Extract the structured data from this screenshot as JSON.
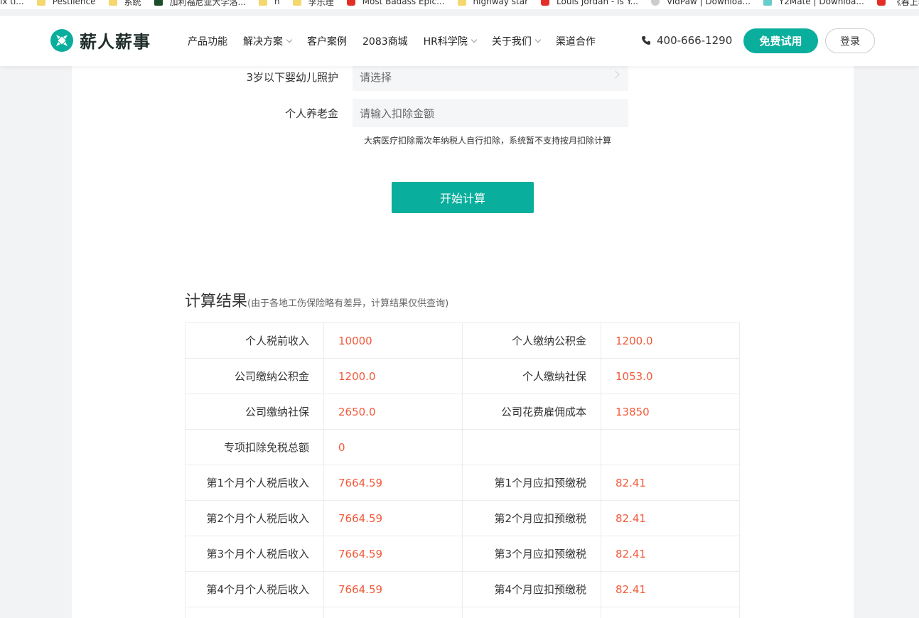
{
  "bookmarks": [
    {
      "label": "ix ti...",
      "icon": "none"
    },
    {
      "label": "Pestilence",
      "icon": "folder-icon"
    },
    {
      "label": "系统",
      "icon": "folder-icon"
    },
    {
      "label": "加利福尼亚大学洛...",
      "icon": "play-icon"
    },
    {
      "label": "n",
      "icon": "folder-icon"
    },
    {
      "label": "李乐理",
      "icon": "folder-icon"
    },
    {
      "label": "Most Badass Epic...",
      "icon": "youtube-icon"
    },
    {
      "label": "highway star",
      "icon": "folder-icon"
    },
    {
      "label": "Louis Jordan - Is Y...",
      "icon": "youtube-icon"
    },
    {
      "label": "VidPaw | Downloa...",
      "icon": "panda-icon"
    },
    {
      "label": "Y2Mate | Downloa...",
      "icon": "download-icon"
    },
    {
      "label": "《春上春季》",
      "icon": "youtube-icon"
    }
  ],
  "header": {
    "brand": "薪人薪事",
    "nav": [
      {
        "label": "产品功能",
        "dropdown": false
      },
      {
        "label": "解决方案",
        "dropdown": true
      },
      {
        "label": "客户案例",
        "dropdown": false
      },
      {
        "label": "2083商城",
        "dropdown": false
      },
      {
        "label": "HR科学院",
        "dropdown": true
      },
      {
        "label": "关于我们",
        "dropdown": true
      },
      {
        "label": "渠道合作",
        "dropdown": false
      }
    ],
    "phone": "400-666-1290",
    "trial_label": "免费试用",
    "login_label": "登录",
    "accent_color": "#0aae9c"
  },
  "form": {
    "infant_care": {
      "label": "3岁以下婴幼儿照护",
      "placeholder": "请选择"
    },
    "pension": {
      "label": "个人养老金",
      "placeholder": "请输入扣除金额"
    },
    "note": "大病医疗扣除需次年纳税人自行扣除，系统暂不支持按月扣除计算",
    "calc_label": "开始计算"
  },
  "results": {
    "title": "计算结果",
    "subtitle": "(由于各地工伤保险略有差异，计算结果仅供查询)",
    "value_color": "#f25a3a",
    "rows": [
      {
        "l1": "个人税前收入",
        "v1": "10000",
        "l2": "个人缴纳公积金",
        "v2": "1200.0"
      },
      {
        "l1": "公司缴纳公积金",
        "v1": "1200.0",
        "l2": "个人缴纳社保",
        "v2": "1053.0"
      },
      {
        "l1": "公司缴纳社保",
        "v1": "2650.0",
        "l2": "公司花费雇佣成本",
        "v2": "13850"
      },
      {
        "l1": "专项扣除免税总额",
        "v1": "0",
        "l2": "",
        "v2": ""
      },
      {
        "l1": "第1个月个人税后收入",
        "v1": "7664.59",
        "l2": "第1个月应扣预缴税",
        "v2": "82.41"
      },
      {
        "l1": "第2个月个人税后收入",
        "v1": "7664.59",
        "l2": "第2个月应扣预缴税",
        "v2": "82.41"
      },
      {
        "l1": "第3个月个人税后收入",
        "v1": "7664.59",
        "l2": "第3个月应扣预缴税",
        "v2": "82.41"
      },
      {
        "l1": "第4个月个人税后收入",
        "v1": "7664.59",
        "l2": "第4个月应扣预缴税",
        "v2": "82.41"
      },
      {
        "l1": "",
        "v1": "",
        "l2": "",
        "v2": ""
      }
    ]
  }
}
